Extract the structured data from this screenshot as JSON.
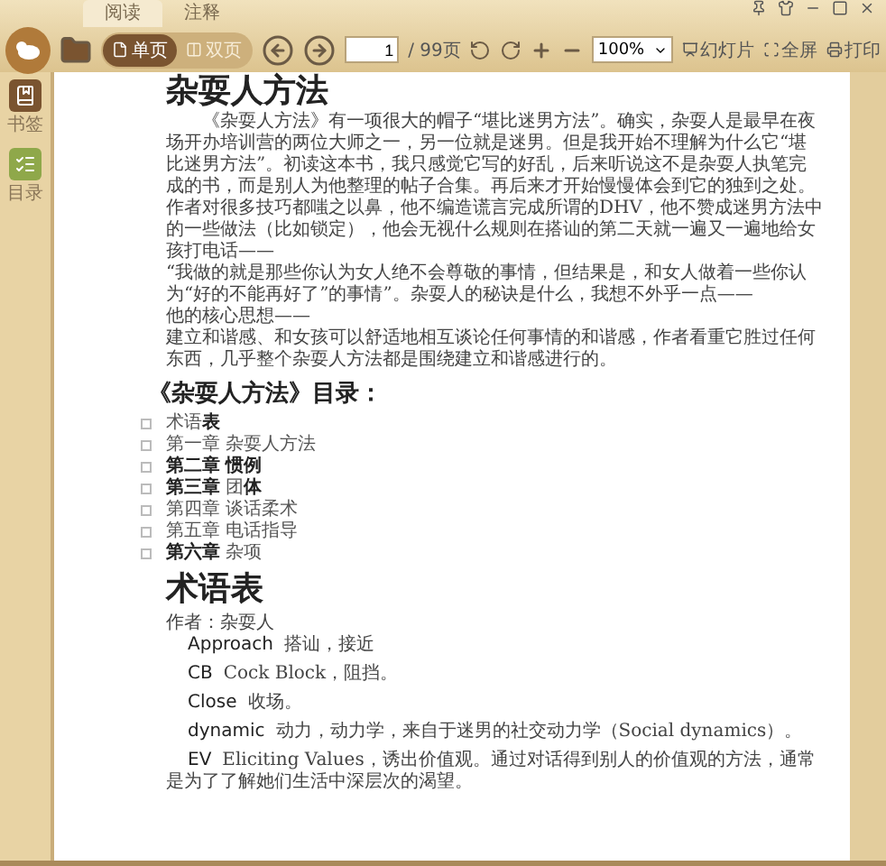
{
  "tabs": [
    {
      "label": "阅读",
      "selected": true
    },
    {
      "label": "注释",
      "selected": false
    }
  ],
  "toolbar": {
    "view_modes": [
      {
        "label": "单页",
        "kind": "single",
        "selected": true
      },
      {
        "label": "双页",
        "kind": "double",
        "selected": false
      }
    ],
    "page_input": {
      "value": "1"
    },
    "page_total": "/ 99页",
    "zoom": {
      "value": "100%"
    },
    "actions": [
      {
        "label": "幻灯片",
        "kind": "slideshow"
      },
      {
        "label": "全屏",
        "kind": "fullscreen"
      },
      {
        "label": "打印",
        "kind": "print"
      }
    ]
  },
  "sidebar": {
    "items": [
      {
        "label": "书签",
        "kind": "bookmark",
        "selected": false
      },
      {
        "label": "目录",
        "kind": "contents",
        "selected": true
      }
    ]
  },
  "document": {
    "title": "杂耍人方法",
    "paragraphs": [
      {
        "text": "《杂耍人方法》有一项很大的帽子“堪比迷男方法”。确实，杂耍人是最早在夜场开办培训营的两位大师之一，另一位就是迷男。但是我开始不理解为什么它“堪比迷男方法”。初读这本书，我只感觉它写的好乱，后来听说这不是杂耍人执笔完成的书，而是别人为他整理的帖子合集。再后来才开始慢慢体会到它的独到之处。作者对很多技巧都嗤之以鼻，他不编造谎言完成所谓的DHV，他不赞成迷男方法中的一些做法（比如锁定），他会无视什么规则在搭讪的第二天就一遍又一遍地给女孩打电话——",
        "indent": true
      },
      {
        "text": "“我做的就是那些你认为女人绝不会尊敬的事情，但结果是，和女人做着一些你认为“好的不能再好了”的事情”。杂耍人的秘诀是什么，我想不外乎一点——",
        "indent": false
      },
      {
        "text": "他的核心思想——",
        "indent": false
      },
      {
        "text": "建立和谐感、和女孩可以舒适地相互谈论任何事情的和谐感，作者看重它胜过任何东西，几乎整个杂耍人方法都是围绕建立和谐感进行的。",
        "indent": false
      }
    ],
    "toc_heading": "《杂耍人方法》目录：",
    "toc": [
      "术语**表**",
      "第一章 杂耍人方法",
      "**第二章** **惯例**",
      "**第三章** 团**体**",
      "第四章 谈话柔术",
      "第五章 电话指导",
      "**第六章** 杂项"
    ],
    "section_title": "术语表",
    "author": "作者：杂耍人",
    "glossary": [
      {
        "term": "Approach",
        "definition": "搭讪，接近"
      },
      {
        "term": "CB",
        "definition": "Cock Block，阻挡。"
      },
      {
        "term": "Close",
        "definition": "收场。"
      },
      {
        "term": "dynamic",
        "definition": "动力，动力学，来自于迷男的社交动力学（Social dynamics）。"
      },
      {
        "term": "EV",
        "definition": "Eliciting Values，诱出价值观。通过对话得到别人的价值观的方法，通常是为了了解她们生活中深层次的渴望。"
      }
    ]
  }
}
